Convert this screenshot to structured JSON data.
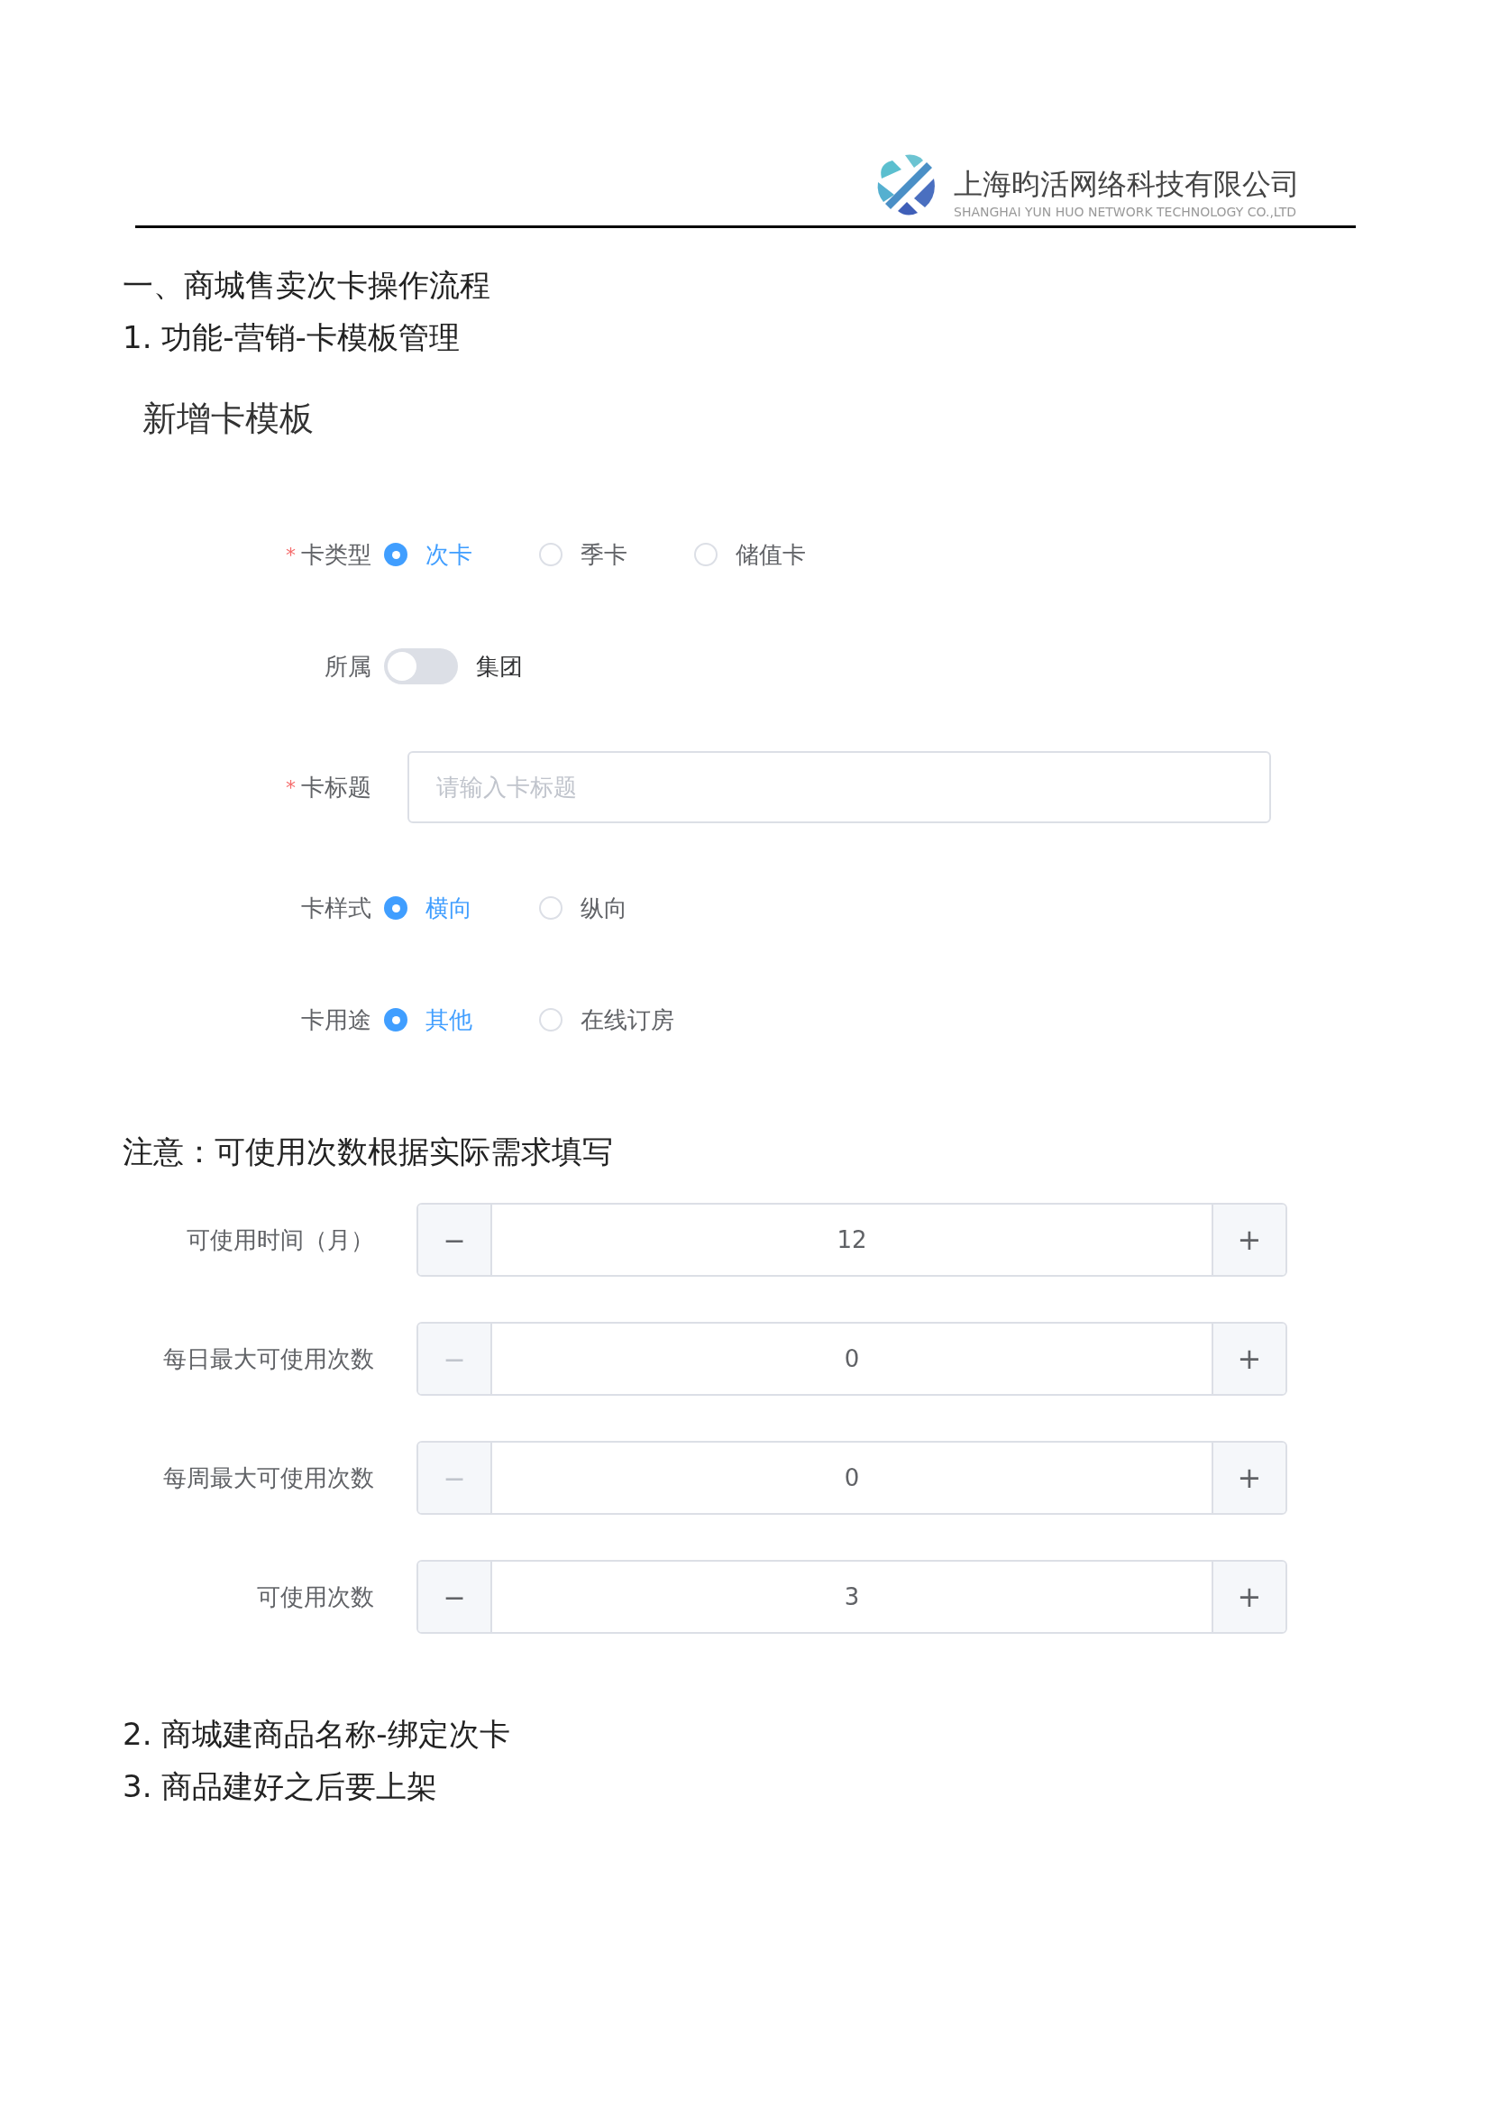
{
  "header": {
    "company_name": "上海昀活网络科技有限公司",
    "company_name_en": "SHANGHAI YUN HUO NETWORK TECHNOLOGY CO.,LTD"
  },
  "top_lines": [
    "一、商城售卖次卡操作流程",
    "1. 功能-营销-卡模板管理"
  ],
  "form": {
    "title": "新增卡模板",
    "fields": [
      {
        "kind": "radio",
        "label": "卡类型",
        "required_mark": "*",
        "options": [
          {
            "label": "次卡",
            "selected": true
          },
          {
            "label": "季卡",
            "selected": false
          },
          {
            "label": "储值卡",
            "selected": false
          }
        ]
      },
      {
        "kind": "switch",
        "label": "所属",
        "on": false,
        "text": "集团"
      },
      {
        "kind": "input",
        "label": "卡标题",
        "required_mark": "*",
        "placeholder": "请输入卡标题"
      },
      {
        "kind": "radio",
        "label": "卡样式",
        "options": [
          {
            "label": "横向",
            "selected": true
          },
          {
            "label": "纵向",
            "selected": false
          }
        ]
      },
      {
        "kind": "radio",
        "label": "卡用途",
        "options": [
          {
            "label": "其他",
            "selected": true
          },
          {
            "label": "在线订房",
            "selected": false
          }
        ]
      }
    ]
  },
  "note": "注意：可使用次数根据实际需求填写",
  "steppers": [
    {
      "label": "可使用时间（月）",
      "value": "12",
      "minus": "−",
      "plus": "+",
      "minus_disabled": false
    },
    {
      "label": "每日最大可使用次数",
      "value": "0",
      "minus": "−",
      "plus": "+",
      "minus_disabled": true
    },
    {
      "label": "每周最大可使用次数",
      "value": "0",
      "minus": "−",
      "plus": "+",
      "minus_disabled": true
    },
    {
      "label": "可使用次数",
      "value": "3",
      "minus": "−",
      "plus": "+",
      "minus_disabled": false
    }
  ],
  "bottom_lines": [
    "2. 商城建商品名称-绑定次卡",
    "3. 商品建好之后要上架"
  ]
}
